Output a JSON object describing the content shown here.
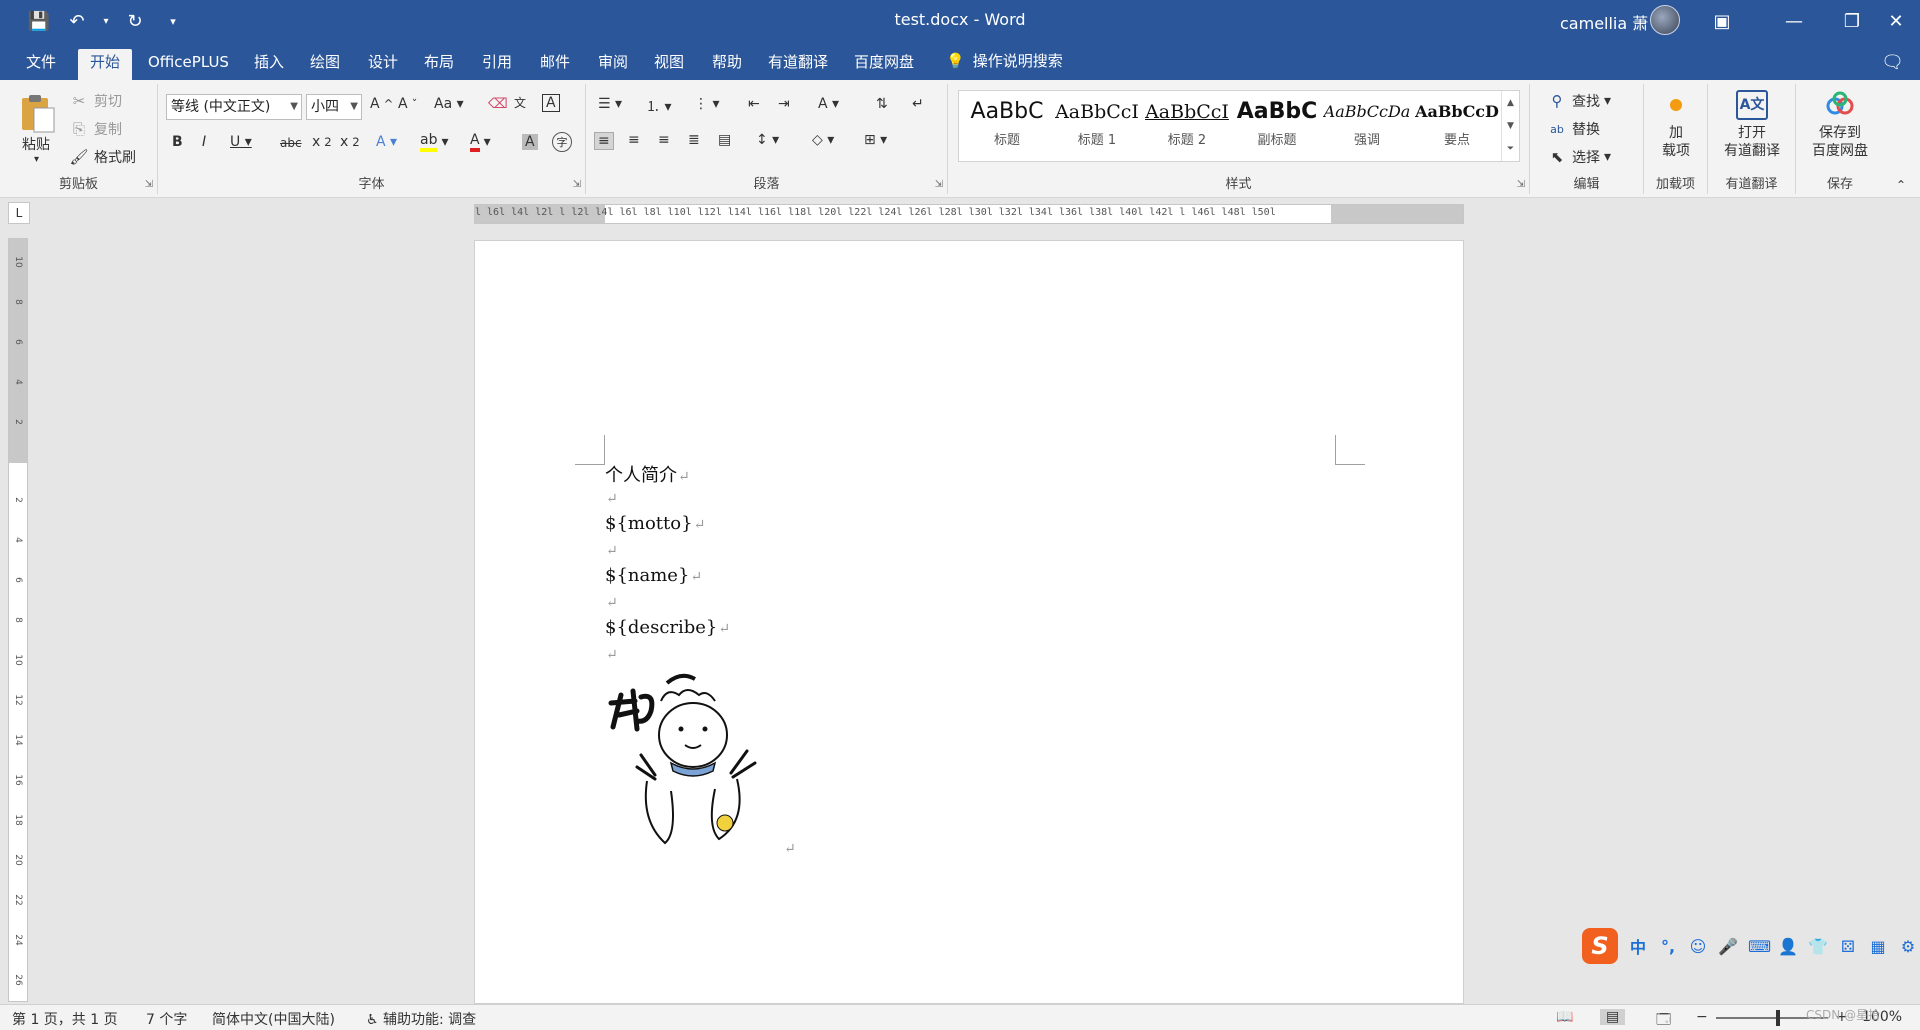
{
  "window": {
    "doc_title": "test.docx  -  Word",
    "user_name": "camellia 萧"
  },
  "tabs": [
    "文件",
    "开始",
    "OfficePLUS",
    "插入",
    "绘图",
    "设计",
    "布局",
    "引用",
    "邮件",
    "审阅",
    "视图",
    "帮助",
    "有道翻译",
    "百度网盘"
  ],
  "active_tab": "开始",
  "tell_me": "操作说明搜索",
  "clipboard": {
    "paste": "粘贴",
    "cut": "剪切",
    "copy": "复制",
    "format_painter": "格式刷",
    "label": "剪贴板"
  },
  "font": {
    "family": "等线 (中文正文)",
    "size": "小四",
    "label": "字体"
  },
  "paragraph": {
    "label": "段落"
  },
  "styles": {
    "label": "样式",
    "items": [
      {
        "preview": "AaBbC",
        "name": "标题"
      },
      {
        "preview": "AaBbCcI",
        "name": "标题 1"
      },
      {
        "preview": "AaBbCcI",
        "name": "标题 2"
      },
      {
        "preview": "AaBbC",
        "name": "副标题"
      },
      {
        "preview": "AaBbCcDa",
        "name": "强调"
      },
      {
        "preview": "AaBbCcD",
        "name": "要点"
      }
    ]
  },
  "editing": {
    "find": "查找",
    "replace": "替换",
    "select": "选择",
    "label": "编辑"
  },
  "addins": {
    "button_line1": "加",
    "button_line2": "载项",
    "label": "加载项"
  },
  "youdao": {
    "button_line1": "打开",
    "button_line2": "有道翻译",
    "label": "有道翻译"
  },
  "baidu": {
    "button_line1": "保存到",
    "button_line2": "百度网盘",
    "label": "保存"
  },
  "ruler": {
    "h_marks": "l  l6l  l4l  l2l     l  l2l  l4l  l6l  l8l  l10l  l12l  l14l  l16l  l18l  l20l  l22l  l24l  l26l  l28l  l30l  l32l  l34l  l36l  l38l  l40l  l42l     l  l46l  l48l  l50l",
    "v_marks": [
      "10",
      "8",
      "6",
      "4",
      "2",
      "2",
      "4",
      "6",
      "8",
      "10",
      "12",
      "14",
      "16",
      "18",
      "20",
      "22",
      "24",
      "26"
    ]
  },
  "document": {
    "paragraphs": [
      "个人简介",
      "",
      "${motto}",
      "",
      "${name}",
      "",
      "${describe}",
      ""
    ],
    "pilcrow": "↵"
  },
  "ime": [
    "中",
    "°,",
    "☺",
    "🎤",
    "⌨",
    "👤",
    "👕",
    "⚄",
    "▦",
    "⚙"
  ],
  "status": {
    "page": "第 1 页，共 1 页",
    "words": "7 个字",
    "language": "简体中文(中国大陆)",
    "accessibility": "辅助功能: 调查",
    "zoom": "100%"
  },
  "watermark": "CSDN @星拾",
  "colors": {
    "brand": "#2b579a",
    "highlight": "#ffff00",
    "font_color": "#e02020"
  }
}
